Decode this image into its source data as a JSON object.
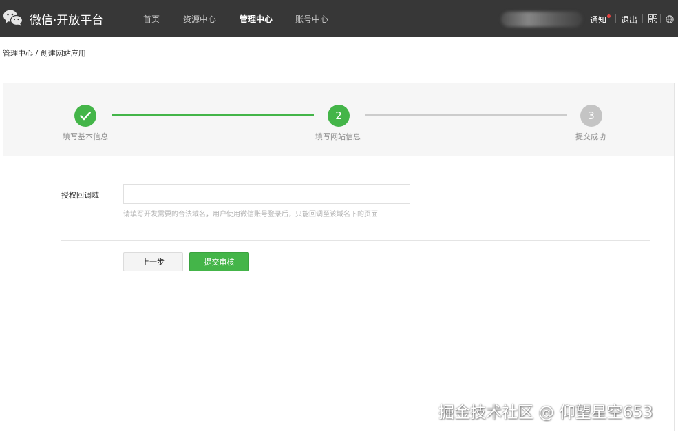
{
  "header": {
    "brand": "微信·开放平台",
    "logo_icon": "wechat-logo-icon",
    "nav": [
      {
        "label": "首页",
        "active": false
      },
      {
        "label": "资源中心",
        "active": false
      },
      {
        "label": "管理中心",
        "active": true
      },
      {
        "label": "账号中心",
        "active": false
      }
    ],
    "notify_label": "通知",
    "logout_label": "退出",
    "qr_icon": "qr-code-icon",
    "globe_icon": "globe-icon"
  },
  "breadcrumb": {
    "parent": "管理中心",
    "separator": " / ",
    "current": "创建网站应用"
  },
  "steps": [
    {
      "number": "",
      "label": "填写基本信息",
      "status": "done",
      "icon": "checkmark-icon"
    },
    {
      "number": "2",
      "label": "填写网站信息",
      "status": "active"
    },
    {
      "number": "3",
      "label": "提交成功",
      "status": "pending"
    }
  ],
  "form": {
    "callback_label": "授权回调域",
    "callback_value": "",
    "callback_hint": "请填写开发需要的合法域名，用户使用微信账号登录后，只能回调至该域名下的页面"
  },
  "buttons": {
    "prev": "上一步",
    "submit": "提交审核"
  },
  "watermark": "掘金技术社区 @ 仰望星空653",
  "colors": {
    "topbar": "#373737",
    "accent": "#44b549",
    "pending": "#c4c4c4",
    "notify_dot": "#e64340"
  }
}
